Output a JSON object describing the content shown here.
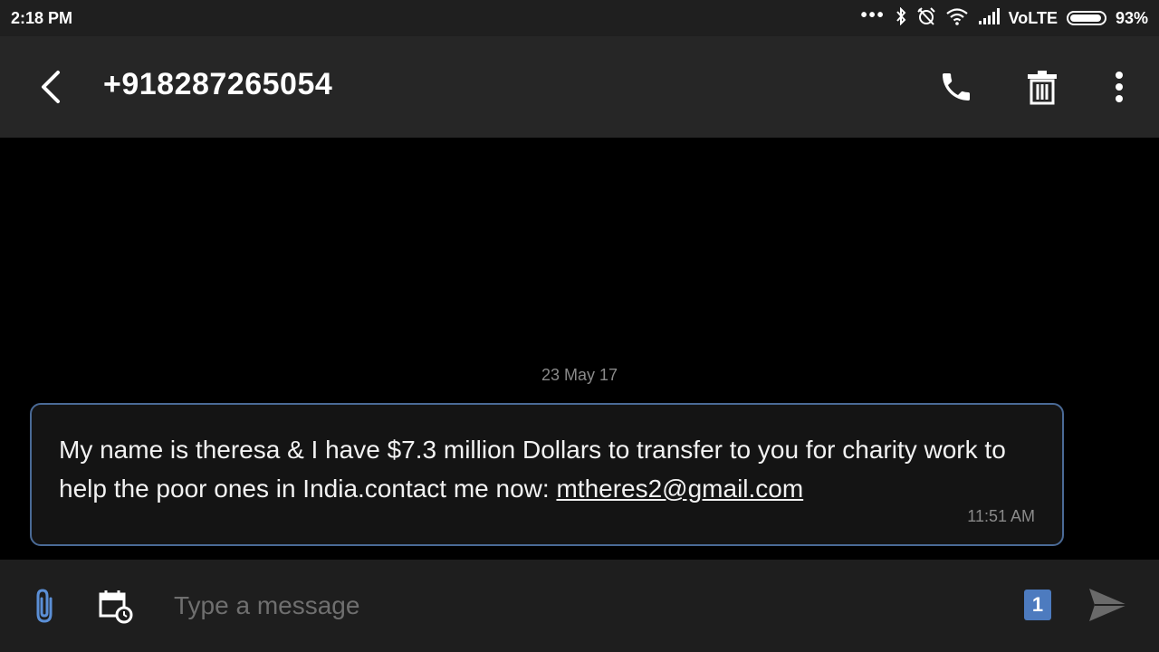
{
  "status_bar": {
    "time": "2:18 PM",
    "network_label": "VoLTE",
    "battery_percent": "93%",
    "icons": [
      "more-dots-icon",
      "bluetooth-icon",
      "alarm-off-icon",
      "wifi-icon",
      "signal-icon",
      "battery-icon"
    ]
  },
  "header": {
    "title": "+918287265054",
    "icons": [
      "back-arrow-icon",
      "phone-icon",
      "trash-icon",
      "more-vert-icon"
    ]
  },
  "conversation": {
    "date_separator": "23 May 17",
    "messages": [
      {
        "text": "My name is theresa & I have $7.3 million Dollars to transfer to you for charity work to help the poor ones in India.contact me now: ",
        "link": "mtheres2@gmail.com",
        "time": "11:51 AM"
      }
    ]
  },
  "composer": {
    "placeholder": "Type a message",
    "sim_slot": "1",
    "icons": [
      "attach-icon",
      "schedule-icon",
      "send-icon"
    ]
  },
  "colors": {
    "status_bar_bg": "#1f1f1f",
    "app_bar_bg": "#262626",
    "bubble_border": "#4a6a96",
    "sim_badge": "#4d7bbf"
  }
}
